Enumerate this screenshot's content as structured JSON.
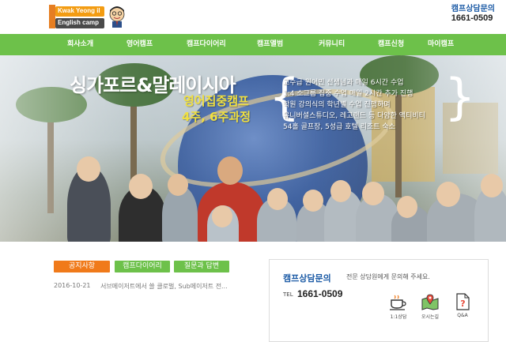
{
  "header": {
    "logo_line1": "Kwak Yeong il",
    "logo_line2": "English camp",
    "hotline_label": "캠프상담문의",
    "hotline_number": "1661-0509"
  },
  "nav": {
    "items": [
      {
        "label": "회사소개"
      },
      {
        "label": "영어캠프"
      },
      {
        "label": "캠프다이어리"
      },
      {
        "label": "캠프앨범"
      },
      {
        "label": "커뮤니티"
      },
      {
        "label": "캠프신청"
      },
      {
        "label": "마이캠프"
      }
    ]
  },
  "hero": {
    "title": "싱가포르&말레이시아",
    "subtitle1": "영어집중캠프",
    "subtitle2": "4주, 6주과정",
    "features": [
      "교수급 원어민 선생님과 매일 6시간 수업",
      "1:4 소그룹 집중 수업 매일 2시간 추가 진행",
      "학원 강의식의 학년별 수업 진행하며",
      "유니버셜스튜디오, 레고랜드 등 다양한 액티비티",
      "54홀 골프장, 5성급 호텔 리조트 숙소"
    ]
  },
  "board": {
    "tabs": [
      {
        "label": "공지사항",
        "color": "#f07a1a"
      },
      {
        "label": "캠프다이어리",
        "color": "#6dc14a"
      },
      {
        "label": "질문과 답변",
        "color": "#6dc14a"
      }
    ],
    "notice": {
      "date": "2016-10-21",
      "title": "서브메이저트에서 쓸 클로벌, Sub메이저트 전..."
    }
  },
  "counsel": {
    "title": "캠프상담문의",
    "description": "전문 상담원에게 문의해 주세요.",
    "tel_label": "TEL",
    "tel_number": "1661-0509",
    "quick_links": [
      {
        "label": "1:1상담",
        "icon": "coffee-cup-icon"
      },
      {
        "label": "오시는길",
        "icon": "map-pin-icon"
      },
      {
        "label": "Q&A",
        "icon": "question-document-icon"
      }
    ]
  }
}
